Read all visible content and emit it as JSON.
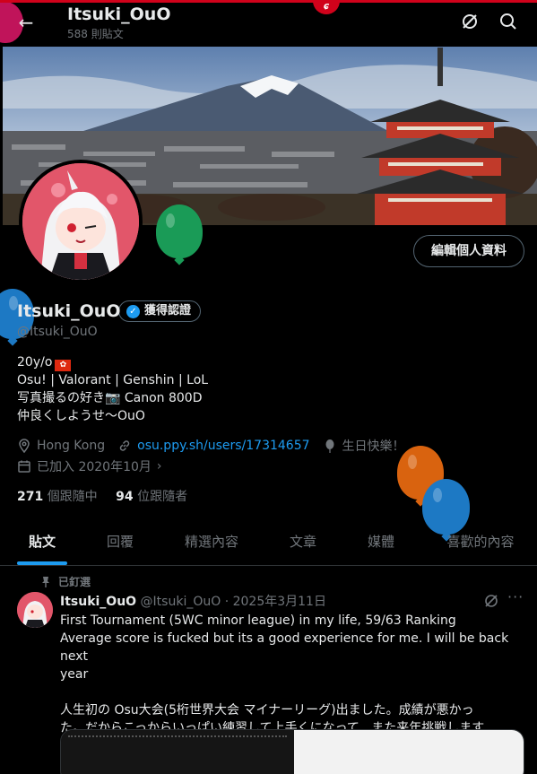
{
  "header": {
    "name": "Itsuki_OuO",
    "post_count": "588 則貼文",
    "notch_glyph": "ɕ"
  },
  "profile": {
    "display_name": "Itsuki_OuO",
    "verified_label": "獲得認證",
    "handle": "@Itsuki_OuO",
    "edit_button": "編輯個人資料",
    "bio": [
      "20y/o",
      "Osu! | Valorant | Genshin | LoL",
      "写真撮るの好き📷 Canon 800D",
      "仲良くしようせ〜OuO"
    ],
    "flag": "🇭🇰",
    "location": "Hong Kong",
    "website": "osu.ppy.sh/users/17314657",
    "birthday": "生日快樂！",
    "joined": "已加入 2020年10月",
    "following_count": "271",
    "following_label": "個跟隨中",
    "followers_count": "94",
    "followers_label": "位跟隨者"
  },
  "tabs": [
    "貼文",
    "回覆",
    "精選內容",
    "文章",
    "媒體",
    "喜歡的內容"
  ],
  "pinned_label": "已釘選",
  "post": {
    "author": "Itsuki_OuO",
    "handle_date": "@Itsuki_OuO · 2025年3月11日",
    "lines": [
      "First Tournament (5WC minor league) in my life, 59/63 Ranking",
      "Average score is fucked but its a good experience for me. I will be back next",
      "year",
      "",
      "人生初の Osu大会(5桁世界大会 マイナーリーグ)出ました。成績が悪かっ",
      "た。だからこっからいっぱい練習して上手くになって、また来年挑戦します"
    ],
    "more": "···"
  },
  "colors": {
    "accent": "#1d9bf0",
    "background": "#000000",
    "text": "#e7e9ea",
    "muted": "#71767b",
    "balloons": [
      "#c0145a",
      "#1a9b57",
      "#1d79c4",
      "#d9630f",
      "#1d79c4"
    ]
  }
}
